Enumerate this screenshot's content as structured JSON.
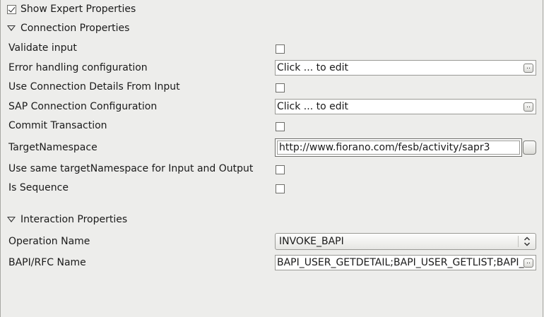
{
  "header": {
    "show_expert_label": "Show Expert Properties",
    "show_expert_checked": true
  },
  "connection": {
    "section_title": "Connection Properties",
    "validate_input": {
      "label": "Validate input",
      "checked": false
    },
    "error_handling": {
      "label": "Error handling configuration",
      "value": "Click ... to edit",
      "button_label": ".."
    },
    "use_conn_details": {
      "label": "Use Connection Details From Input",
      "checked": false
    },
    "sap_conn_config": {
      "label": "SAP Connection Configuration",
      "value": "Click ... to edit",
      "button_label": ".."
    },
    "commit_transaction": {
      "label": "Commit Transaction",
      "checked": false
    },
    "target_namespace": {
      "label": "TargetNamespace",
      "value": "http://www.fiorano.com/fesb/activity/sapr3"
    },
    "same_target_ns": {
      "label": "Use same targetNamespace for Input and Output",
      "checked": false
    },
    "is_sequence": {
      "label": "Is Sequence",
      "checked": false
    }
  },
  "interaction": {
    "section_title": "Interaction Properties",
    "operation_name": {
      "label": "Operation Name",
      "value": "INVOKE_BAPI"
    },
    "bapi_rfc_name": {
      "label": "BAPI/RFC Name",
      "value": "BAPI_USER_GETDETAIL;BAPI_USER_GETLIST;BAPI_USER_CHANGE",
      "button_label": ".."
    }
  }
}
